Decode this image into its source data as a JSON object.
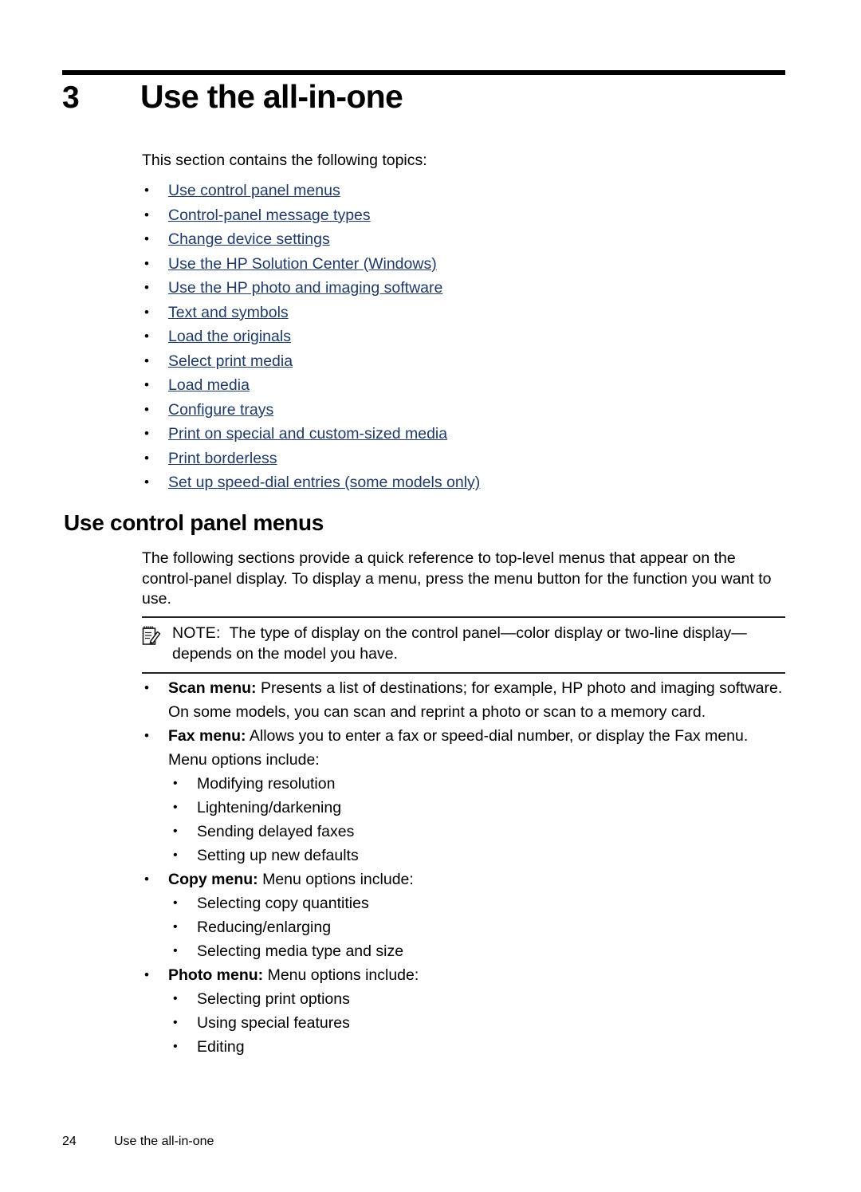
{
  "chapter": {
    "number": "3",
    "title": "Use the all-in-one"
  },
  "intro": "This section contains the following topics:",
  "toc": {
    "bullet": "•",
    "links": [
      "Use control panel menus",
      "Control-panel message types",
      "Change device settings",
      "Use the HP Solution Center (Windows)",
      "Use the HP photo and imaging software",
      "Text and symbols",
      "Load the originals",
      "Select print media",
      "Load media",
      "Configure trays",
      "Print on special and custom-sized media",
      "Print borderless",
      "Set up speed-dial entries (some models only)"
    ]
  },
  "section": {
    "heading": "Use control panel menus",
    "paragraph": "The following sections provide a quick reference to top-level menus that appear on the control-panel display. To display a menu, press the menu button for the function you want to use."
  },
  "note": {
    "icon_name": "note-pencil-icon",
    "label": "NOTE:",
    "text": "The type of display on the control panel—color display or two-line display—depends on the model you have."
  },
  "menus": {
    "bullet": "•",
    "sub_bullet": "•",
    "items": [
      {
        "term": "Scan menu:",
        "description": "Presents a list of destinations; for example, HP photo and imaging software. On some models, you can scan and reprint a photo or scan to a memory card.",
        "sub_items": []
      },
      {
        "term": "Fax menu:",
        "description": "Allows you to enter a fax or speed-dial number, or display the Fax menu. Menu options include:",
        "sub_items": [
          "Modifying resolution",
          "Lightening/darkening",
          "Sending delayed faxes",
          "Setting up new defaults"
        ]
      },
      {
        "term": "Copy menu:",
        "description": "Menu options include:",
        "sub_items": [
          "Selecting copy quantities",
          "Reducing/enlarging",
          "Selecting media type and size"
        ]
      },
      {
        "term": "Photo menu:",
        "description": "Menu options include:",
        "sub_items": [
          "Selecting print options",
          "Using special features",
          "Editing"
        ]
      }
    ]
  },
  "footer": {
    "page_number": "24",
    "title": "Use the all-in-one"
  },
  "colors": {
    "link": "#1f3a66",
    "text": "#000000",
    "rule": "#000000"
  }
}
